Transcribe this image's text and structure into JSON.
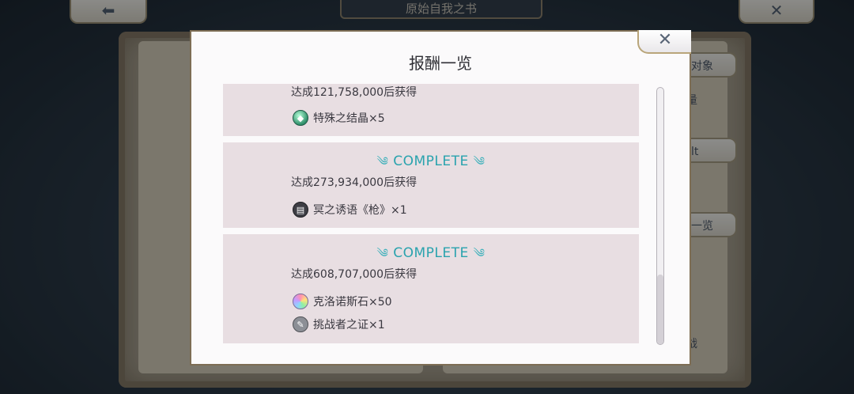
{
  "background": {
    "book_title": "原始自我之书",
    "back_icon": "back-arrow-icon",
    "exit_icon": "close-x-icon",
    "side_labels": [
      "对象",
      "量",
      "lt",
      "一览",
      "战"
    ]
  },
  "modal": {
    "title": "报酬一览",
    "close_icon": "close-x-icon",
    "complete_label": "COMPLETE",
    "rewards": [
      {
        "condition": "达成121,758,000后获得",
        "complete": false,
        "items": [
          {
            "icon": "crystal-icon",
            "name": "特殊之结晶×5"
          }
        ]
      },
      {
        "condition": "达成273,934,000后获得",
        "complete": true,
        "items": [
          {
            "icon": "book-icon",
            "name": "冥之诱语《枪》×1"
          }
        ]
      },
      {
        "condition": "达成608,707,000后获得",
        "complete": true,
        "items": [
          {
            "icon": "rainbow-stone-icon",
            "name": "克洛诺斯石×50"
          },
          {
            "icon": "challenger-proof-icon",
            "name": "挑战者之证×1"
          }
        ]
      }
    ]
  },
  "colors": {
    "accent_complete": "#2aa3ae",
    "card_bg": "#e8dee2",
    "modal_border": "#7d6d54"
  }
}
